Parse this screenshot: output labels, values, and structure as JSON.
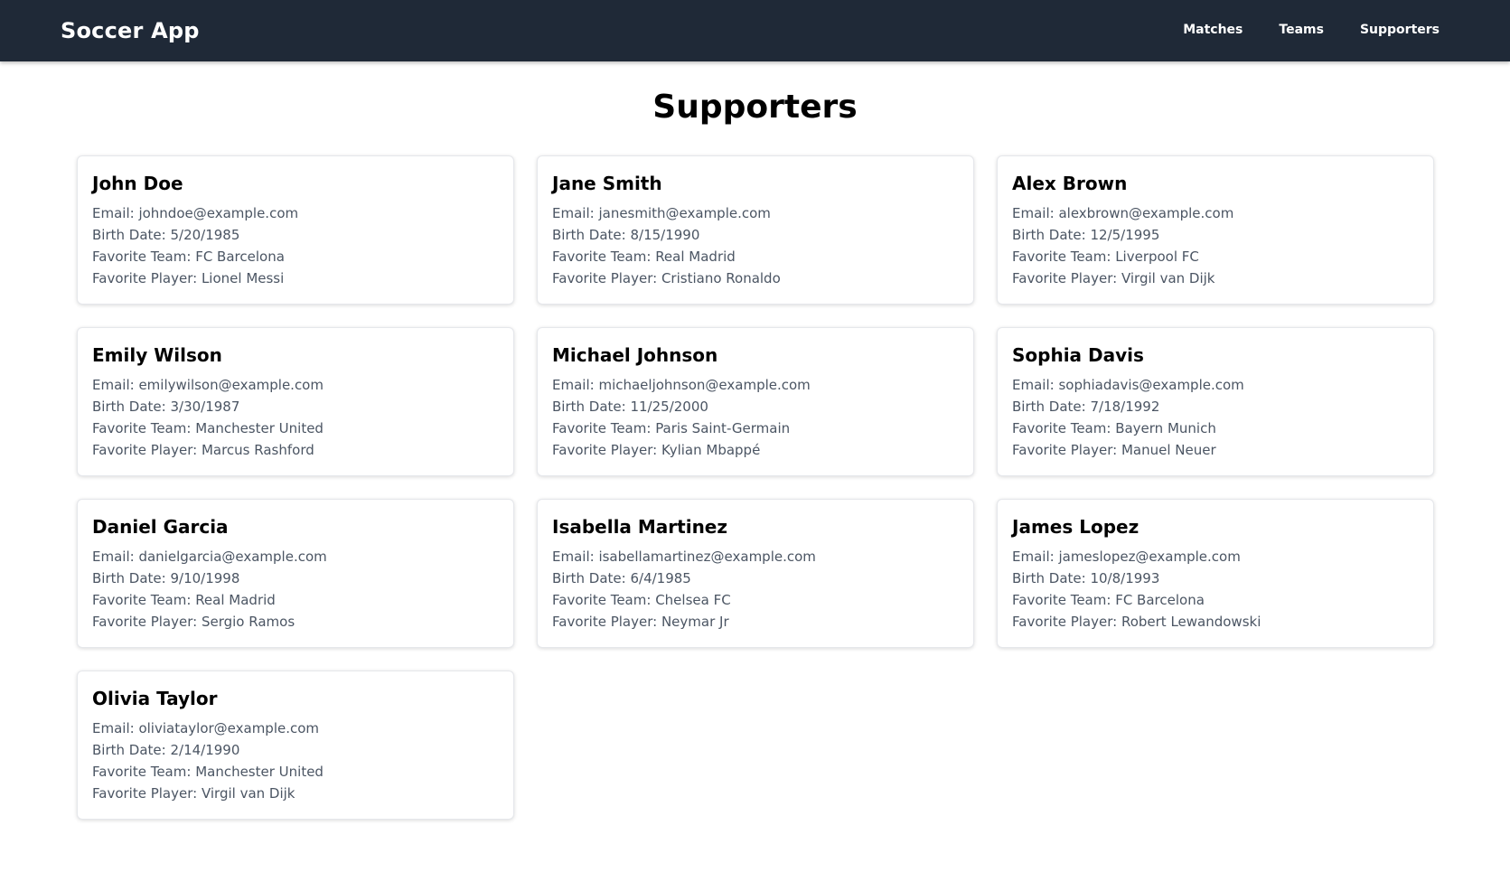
{
  "app": {
    "brand": "Soccer App",
    "nav": [
      "Matches",
      "Teams",
      "Supporters"
    ]
  },
  "page": {
    "title": "Supporters"
  },
  "labels": {
    "email": "Email: ",
    "birth_date": "Birth Date: ",
    "favorite_team": "Favorite Team: ",
    "favorite_player": "Favorite Player: "
  },
  "supporters": [
    {
      "name": "John Doe",
      "email": "johndoe@example.com",
      "birth_date": "5/20/1985",
      "favorite_team": "FC Barcelona",
      "favorite_player": "Lionel Messi"
    },
    {
      "name": "Jane Smith",
      "email": "janesmith@example.com",
      "birth_date": "8/15/1990",
      "favorite_team": "Real Madrid",
      "favorite_player": "Cristiano Ronaldo"
    },
    {
      "name": "Alex Brown",
      "email": "alexbrown@example.com",
      "birth_date": "12/5/1995",
      "favorite_team": "Liverpool FC",
      "favorite_player": "Virgil van Dijk"
    },
    {
      "name": "Emily Wilson",
      "email": "emilywilson@example.com",
      "birth_date": "3/30/1987",
      "favorite_team": "Manchester United",
      "favorite_player": "Marcus Rashford"
    },
    {
      "name": "Michael Johnson",
      "email": "michaeljohnson@example.com",
      "birth_date": "11/25/2000",
      "favorite_team": "Paris Saint-Germain",
      "favorite_player": "Kylian Mbappé"
    },
    {
      "name": "Sophia Davis",
      "email": "sophiadavis@example.com",
      "birth_date": "7/18/1992",
      "favorite_team": "Bayern Munich",
      "favorite_player": "Manuel Neuer"
    },
    {
      "name": "Daniel Garcia",
      "email": "danielgarcia@example.com",
      "birth_date": "9/10/1998",
      "favorite_team": "Real Madrid",
      "favorite_player": "Sergio Ramos"
    },
    {
      "name": "Isabella Martinez",
      "email": "isabellamartinez@example.com",
      "birth_date": "6/4/1985",
      "favorite_team": "Chelsea FC",
      "favorite_player": "Neymar Jr"
    },
    {
      "name": "James Lopez",
      "email": "jameslopez@example.com",
      "birth_date": "10/8/1993",
      "favorite_team": "FC Barcelona",
      "favorite_player": "Robert Lewandowski"
    },
    {
      "name": "Olivia Taylor",
      "email": "oliviataylor@example.com",
      "birth_date": "2/14/1990",
      "favorite_team": "Manchester United",
      "favorite_player": "Virgil van Dijk"
    }
  ]
}
